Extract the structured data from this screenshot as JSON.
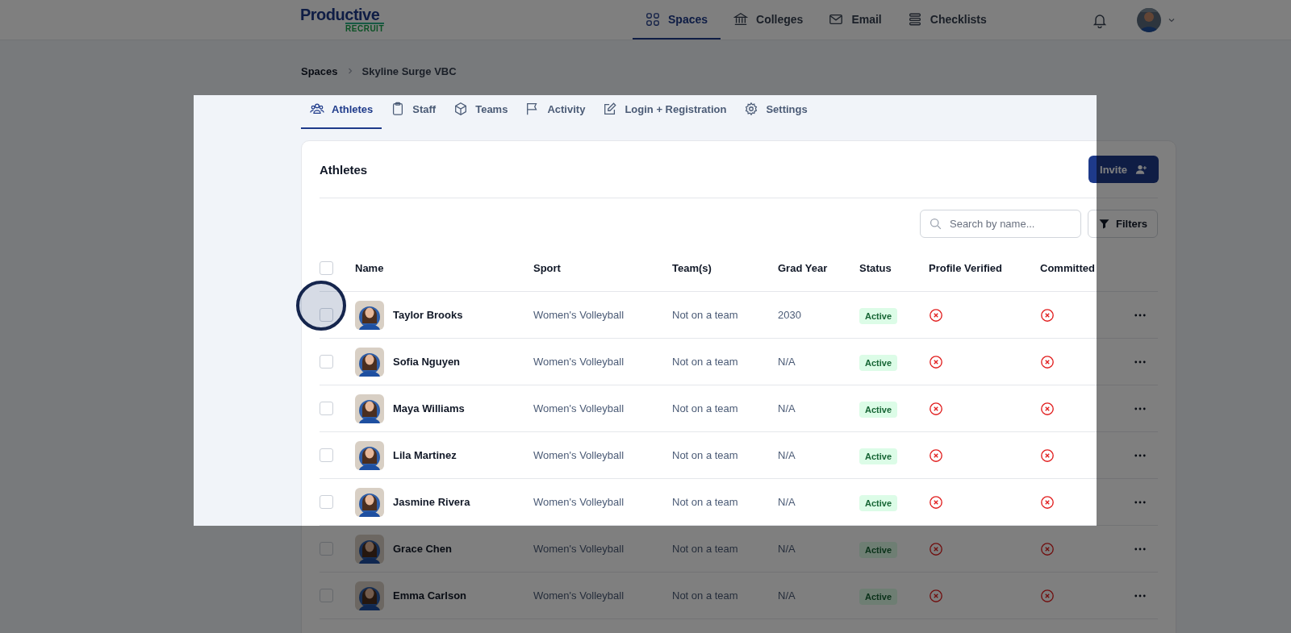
{
  "logo": {
    "top": "Productive",
    "bottom": "RECRUIT"
  },
  "nav": [
    {
      "label": "Spaces",
      "selected": true
    },
    {
      "label": "Colleges",
      "selected": false
    },
    {
      "label": "Email",
      "selected": false
    },
    {
      "label": "Checklists",
      "selected": false
    }
  ],
  "breadcrumb": [
    "Spaces",
    "Skyline Surge VBC"
  ],
  "tabs": [
    {
      "label": "Athletes",
      "selected": true
    },
    {
      "label": "Staff",
      "selected": false
    },
    {
      "label": "Teams",
      "selected": false
    },
    {
      "label": "Activity",
      "selected": false
    },
    {
      "label": "Login + Registration",
      "selected": false
    },
    {
      "label": "Settings",
      "selected": false
    }
  ],
  "card": {
    "title": "Athletes",
    "invite_button": "Invite",
    "search": {
      "placeholder": "Search by name..."
    },
    "filters_button": "Filters"
  },
  "table": {
    "select_all_checked": false,
    "columns": [
      "Name",
      "Sport",
      "Team(s)",
      "Grad Year",
      "Status",
      "Profile Verified",
      "Committed"
    ],
    "rows": [
      {
        "checked": false,
        "name": "Taylor Brooks",
        "sport": "Women's Volleyball",
        "team": "Not on a team",
        "grad_year": "2030",
        "status": "Active",
        "profile_verified": false,
        "committed": false
      },
      {
        "checked": false,
        "name": "Sofia Nguyen",
        "sport": "Women's Volleyball",
        "team": "Not on a team",
        "grad_year": "N/A",
        "status": "Active",
        "profile_verified": false,
        "committed": false
      },
      {
        "checked": false,
        "name": "Maya Williams",
        "sport": "Women's Volleyball",
        "team": "Not on a team",
        "grad_year": "N/A",
        "status": "Active",
        "profile_verified": false,
        "committed": false
      },
      {
        "checked": false,
        "name": "Lila Martinez",
        "sport": "Women's Volleyball",
        "team": "Not on a team",
        "grad_year": "N/A",
        "status": "Active",
        "profile_verified": false,
        "committed": false
      },
      {
        "checked": false,
        "name": "Jasmine Rivera",
        "sport": "Women's Volleyball",
        "team": "Not on a team",
        "grad_year": "N/A",
        "status": "Active",
        "profile_verified": false,
        "committed": false
      },
      {
        "checked": false,
        "name": "Grace Chen",
        "sport": "Women's Volleyball",
        "team": "Not on a team",
        "grad_year": "N/A",
        "status": "Active",
        "profile_verified": false,
        "committed": false
      },
      {
        "checked": false,
        "name": "Emma Carlson",
        "sport": "Women's Volleyball",
        "team": "Not on a team",
        "grad_year": "N/A",
        "status": "Active",
        "profile_verified": false,
        "committed": false
      }
    ]
  }
}
